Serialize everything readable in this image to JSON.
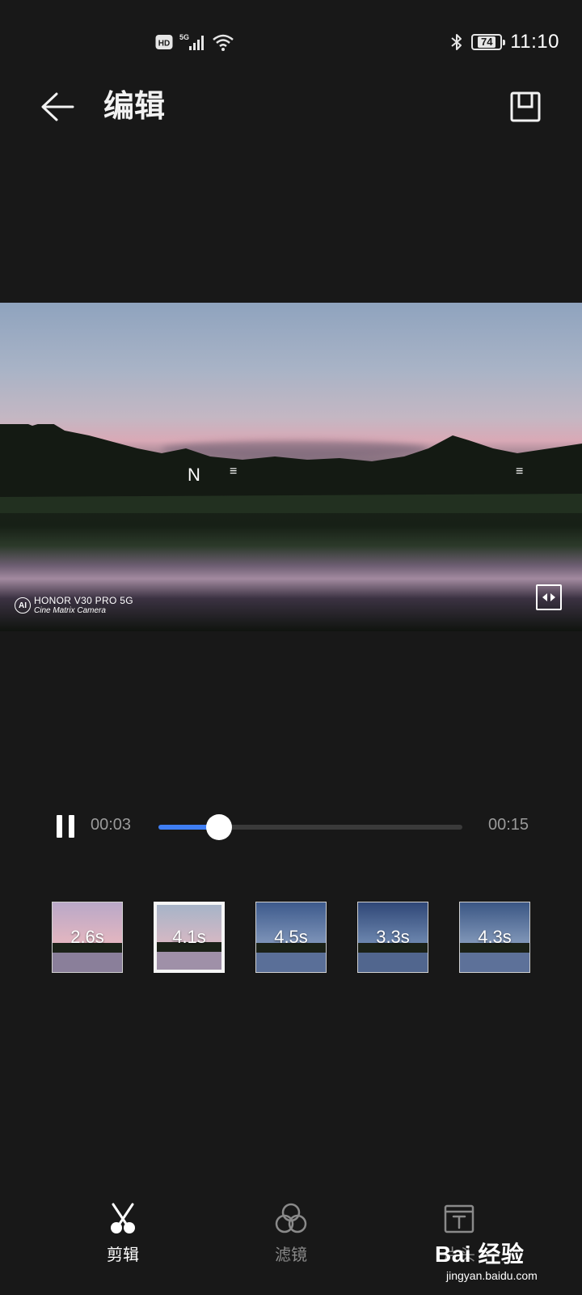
{
  "status_bar": {
    "hd_label": "HD",
    "network_label": "5G",
    "battery_level": "74",
    "time": "11:10"
  },
  "header": {
    "title": "编辑"
  },
  "preview": {
    "overlay_mark_n": "N",
    "overlay_mark_e1": "≡",
    "overlay_mark_e2": "≡",
    "watermark_badge": "AI",
    "watermark_line1": "HONOR V30 PRO 5G",
    "watermark_line2": "Cine Matrix Camera"
  },
  "playback": {
    "current_time": "00:03",
    "total_time": "00:15",
    "progress_fraction": 0.2
  },
  "clips": [
    {
      "duration": "2.6s",
      "selected": false,
      "sky": "linear-gradient(to bottom, #b9a8c8, #e3b6c0)",
      "water": "#8a7f9a"
    },
    {
      "duration": "4.1s",
      "selected": true,
      "sky": "linear-gradient(to bottom, #a6b4c8, #d4b8c4)",
      "water": "#9f90a8"
    },
    {
      "duration": "4.5s",
      "selected": false,
      "sky": "linear-gradient(to bottom, #3d5a8c, #7d93b8)",
      "water": "#5a6f98"
    },
    {
      "duration": "3.3s",
      "selected": false,
      "sky": "linear-gradient(to bottom, #2f4777, #6c86ae)",
      "water": "#51668e"
    },
    {
      "duration": "4.3s",
      "selected": false,
      "sky": "linear-gradient(to bottom, #3a5684, #8096b8)",
      "water": "#5d7199"
    }
  ],
  "bottom_nav": {
    "items": [
      {
        "label": "剪辑",
        "icon": "scissors-icon",
        "active": true
      },
      {
        "label": "滤镜",
        "icon": "filter-icon",
        "active": false
      },
      {
        "label": "片头",
        "icon": "title-icon",
        "active": false
      }
    ]
  },
  "watermark_site": {
    "brand": "Bai 经验",
    "url": "jingyan.baidu.com"
  },
  "colors": {
    "background": "#181818",
    "accent": "#3f7ef3",
    "text_primary": "#ffffff",
    "text_secondary": "#9a9a9a"
  }
}
